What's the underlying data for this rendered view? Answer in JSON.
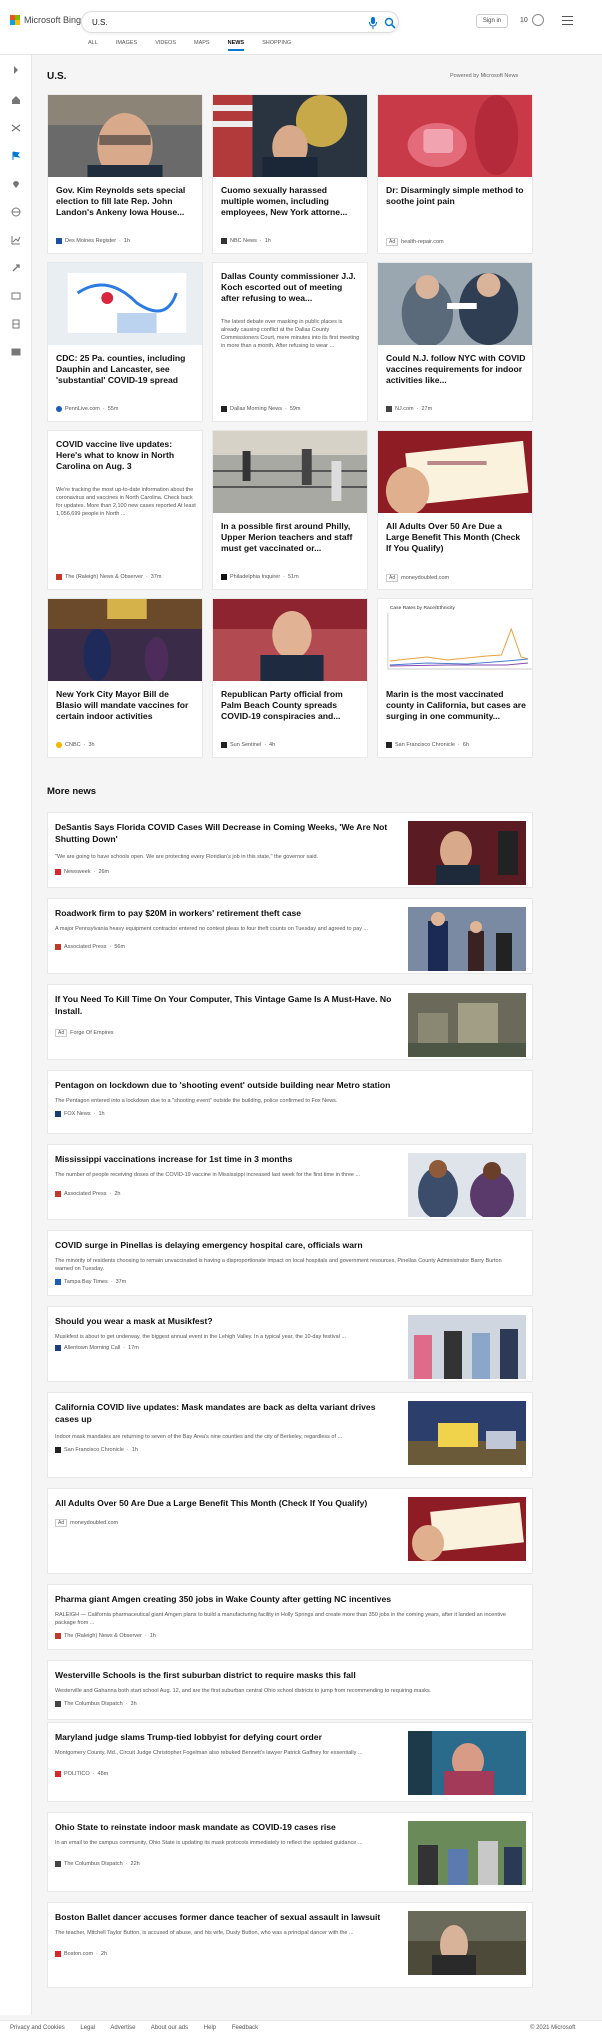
{
  "header": {
    "brand": "Microsoft Bing",
    "search_value": "U.S.",
    "sign_in": "Sign in",
    "rewards_count": "10"
  },
  "nav": [
    "ALL",
    "IMAGES",
    "VIDEOS",
    "MAPS",
    "NEWS",
    "SHOPPING"
  ],
  "section": {
    "title": "U.S.",
    "powered_by": "Powered by Microsoft News"
  },
  "cards": [
    {
      "title": "Gov. Kim Reynolds sets special election to fill late Rep. John Landon's Ankeny Iowa House...",
      "source": "Des Moines Register",
      "time": "1h",
      "src_color": "#1f4ea1"
    },
    {
      "title": "Cuomo sexually harassed multiple women, including employees, New York attorne...",
      "source": "NBC News",
      "time": "1h",
      "src_color": "#333333"
    },
    {
      "title": "Dr: Disarmingly simple method to soothe joint pain",
      "source": "health-repair.com",
      "ad": "Ad"
    },
    {
      "title": "CDC: 25 Pa. counties, including Dauphin and Lancaster, see 'substantial' COVID-19 spread",
      "source": "PennLive.com",
      "time": "55m",
      "src_color": "#1b5cb6"
    },
    {
      "title": "Dallas County commissioner J.J. Koch escorted out of meeting after refusing to wea...",
      "snippet": "The latest debate over masking in public places is already causing conflict at the Dallas County Commissioners Court, mere minutes into its first meeting in more than a month. After refusing to wear ...",
      "source": "Dallas Morning News",
      "time": "59m",
      "src_color": "#222222"
    },
    {
      "title": "Could N.J. follow NYC with COVID vaccines requirements for indoor activities like...",
      "source": "NJ.com",
      "time": "27m",
      "src_color": "#444444"
    },
    {
      "title": "COVID vaccine live updates: Here's what to know in North Carolina on Aug. 3",
      "snippet": "We're tracking the most up-to-date information about the coronavirus and vaccines in North Carolina. Check back for updates. More than 2,100 new cases reported At least 1,056,699 people in North ...",
      "source": "The (Raleigh) News & Observer",
      "time": "37m",
      "src_color": "#c0392b"
    },
    {
      "title": "In a possible first around Philly, Upper Merion teachers and staff must get vaccinated or...",
      "source": "Philadelphia Inquirer",
      "time": "51m",
      "src_color": "#111111"
    },
    {
      "title": "All Adults Over 50 Are Due a Large Benefit This Month (Check If You Qualify)",
      "source": "moneydoubled.com",
      "ad": "Ad"
    },
    {
      "title": "New York City Mayor Bill de Blasio will mandate vaccines for certain indoor activities",
      "source": "CNBC",
      "time": "3h",
      "src_color": "#f4b400"
    },
    {
      "title": "Republican Party official from Palm Beach County spreads COVID-19 conspiracies and...",
      "source": "Sun Sentinel",
      "time": "4h",
      "src_color": "#222222"
    },
    {
      "title": "Marin is the most vaccinated county in California, but cases are surging in one community...",
      "source": "San Francisco Chronicle",
      "time": "6h",
      "src_color": "#222222",
      "chart_caption": "Case Rates by Race/Ethnicity"
    }
  ],
  "more_news": {
    "title": "More news",
    "items": [
      {
        "title": "DeSantis Says Florida COVID Cases Will Decrease in Coming Weeks, 'We Are Not Shutting Down'",
        "snippet": "\"We are going to have schools open. We are protecting every Floridian's job in this state,\" the governor said.",
        "source": "Newsweek",
        "time": "26m",
        "src_color": "#d9262b"
      },
      {
        "title": "Roadwork firm to pay $20M in workers' retirement theft case",
        "snippet": "A major Pennsylvania heavy equipment contractor entered no contest pleas to four theft counts on Tuesday and agreed to pay ...",
        "source": "Associated Press",
        "time": "56m",
        "src_color": "#c0392b"
      },
      {
        "title": "If You Need To Kill Time On Your Computer, This Vintage Game Is A Must-Have. No Install.",
        "source": "Forge Of Empires",
        "ad": "Ad"
      },
      {
        "title": "Pentagon on lockdown due to 'shooting event' outside building near Metro station",
        "snippet": "The Pentagon entered into a lockdown due to a \"shooting event\" outside the building, police confirmed to Fox News.",
        "source": "FOX News",
        "time": "1h",
        "src_color": "#1a3c7b"
      },
      {
        "title": "Mississippi vaccinations increase for 1st time in 3 months",
        "snippet": "The number of people receiving doses of the COVID-19 vaccine in Mississippi increased last week for the first time in three ...",
        "source": "Associated Press",
        "time": "2h",
        "src_color": "#c0392b"
      },
      {
        "title": "COVID surge in Pinellas is delaying emergency hospital care, officials warn",
        "snippet": "The minority of residents choosing to remain unvaccinated is having a disproportionate impact on local hospitals and government resources, Pinellas County Administrator Barry Burton warned on Tuesday.",
        "source": "Tampa Bay Times",
        "time": "37m",
        "src_color": "#1b5cb6"
      },
      {
        "title": "Should you wear a mask at Musikfest?",
        "snippet": "Musikfest is about to get underway, the biggest annual event in the Lehigh Valley. In a typical year, the 10-day festival ...",
        "source": "Allentown Morning Call",
        "time": "17m",
        "src_color": "#1b3f7a"
      },
      {
        "title": "California COVID live updates: Mask mandates are back as delta variant drives cases up",
        "snippet": "Indoor mask mandates are returning to seven of the Bay Area's nine counties and the city of Berkeley, regardless of ...",
        "source": "San Francisco Chronicle",
        "time": "1h",
        "src_color": "#222222"
      },
      {
        "title": "All Adults Over 50 Are Due a Large Benefit This Month (Check If You Qualify)",
        "source": "moneydoubled.com",
        "ad": "Ad"
      },
      {
        "title": "Pharma giant Amgen creating 350 jobs in Wake County after getting NC incentives",
        "snippet": "RALEIGH — California pharmaceutical giant Amgen plans to build a manufacturing facility in Holly Springs and create more than 350 jobs in the coming years, after it landed an incentive package from ...",
        "source": "The (Raleigh) News & Observer",
        "time": "1h",
        "src_color": "#c0392b"
      },
      {
        "title": "Westerville Schools is the first suburban district to require masks this fall",
        "snippet": "Westerville and Gahanna both start school Aug. 12, and are the first suburban central Ohio school districts to jump from recommending to requiring masks.",
        "source": "The Columbus Dispatch",
        "time": "3h",
        "src_color": "#444444"
      },
      {
        "title": "Maryland judge slams Trump-tied lobbyist for defying court order",
        "snippet": "Montgomery County, Md., Circuit Judge Christopher Fogelman also rebuked Bennett's lawyer Patrick Gaffney for essentially ...",
        "source": "POLITICO",
        "time": "48m",
        "src_color": "#d9262b"
      },
      {
        "title": "Ohio State to reinstate indoor mask mandate as COVID-19 cases rise",
        "snippet": "In an email to the campus community, Ohio State is updating its mask protocols immediately to reflect the updated guidance ...",
        "source": "The Columbus Dispatch",
        "time": "22h",
        "src_color": "#444444"
      },
      {
        "title": "Boston Ballet dancer accuses former dance teacher of sexual assault in lawsuit",
        "snippet": "The teacher, Mitchell Taylor Button, is accused of abuse, and his wife, Dusty Button, who was a principal dancer with the ...",
        "source": "Boston.com",
        "time": "2h",
        "src_color": "#d9262b"
      }
    ]
  },
  "footer": {
    "links": [
      "Privacy and Cookies",
      "Legal",
      "Advertise",
      "About our ads",
      "Help",
      "Feedback"
    ],
    "copyright": "© 2021 Microsoft"
  }
}
